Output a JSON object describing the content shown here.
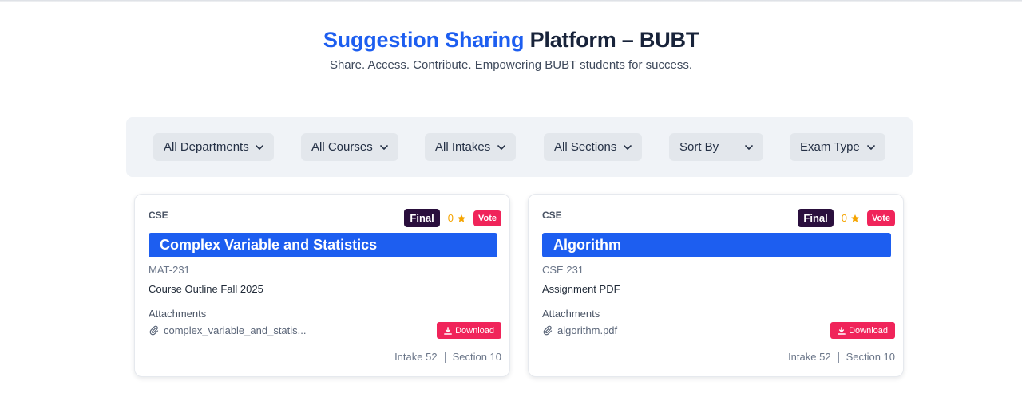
{
  "header": {
    "title_accent": "Suggestion Sharing",
    "title_rest": "Platform – BUBT",
    "subtitle": "Share. Access. Contribute. Empowering BUBT students for success."
  },
  "filters": [
    {
      "label": "All Departments"
    },
    {
      "label": "All Courses"
    },
    {
      "label": "All Intakes"
    },
    {
      "label": "All Sections"
    },
    {
      "label": "Sort By"
    },
    {
      "label": "Exam Type"
    }
  ],
  "cards": [
    {
      "department": "CSE",
      "exam_type": "Final",
      "rating": "0",
      "vote_label": "Vote",
      "title": "Complex Variable and Statistics",
      "course_code": "MAT-231",
      "description": "Course Outline Fall 2025",
      "attachments_label": "Attachments",
      "file_name": "complex_variable_and_statis...",
      "download_label": "Download",
      "intake": "Intake 52",
      "section": "Section 10"
    },
    {
      "department": "CSE",
      "exam_type": "Final",
      "rating": "0",
      "vote_label": "Vote",
      "title": "Algorithm",
      "course_code": "CSE 231",
      "description": "Assignment PDF",
      "attachments_label": "Attachments",
      "file_name": "algorithm.pdf",
      "download_label": "Download",
      "intake": "Intake 52",
      "section": "Section 10"
    }
  ],
  "colors": {
    "accent": "#1d5ef0",
    "danger": "#f0245a",
    "badge_dark": "#2a0f3d",
    "star": "#f5a400"
  }
}
